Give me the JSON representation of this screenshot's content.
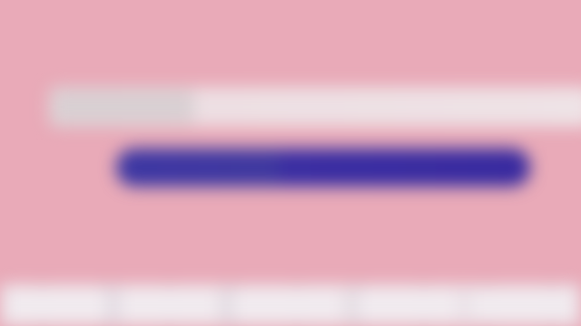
{
  "app": {
    "background_color": "#e9aab8",
    "content_legible": false
  },
  "form": {
    "field_label": "",
    "field_value": "",
    "field_color": "#eee3e6"
  },
  "primary_action": {
    "label": "",
    "color": "#3a2ea2"
  },
  "footer": {
    "items": [
      "",
      "",
      "",
      "",
      ""
    ],
    "color": "#ebe3e8"
  }
}
